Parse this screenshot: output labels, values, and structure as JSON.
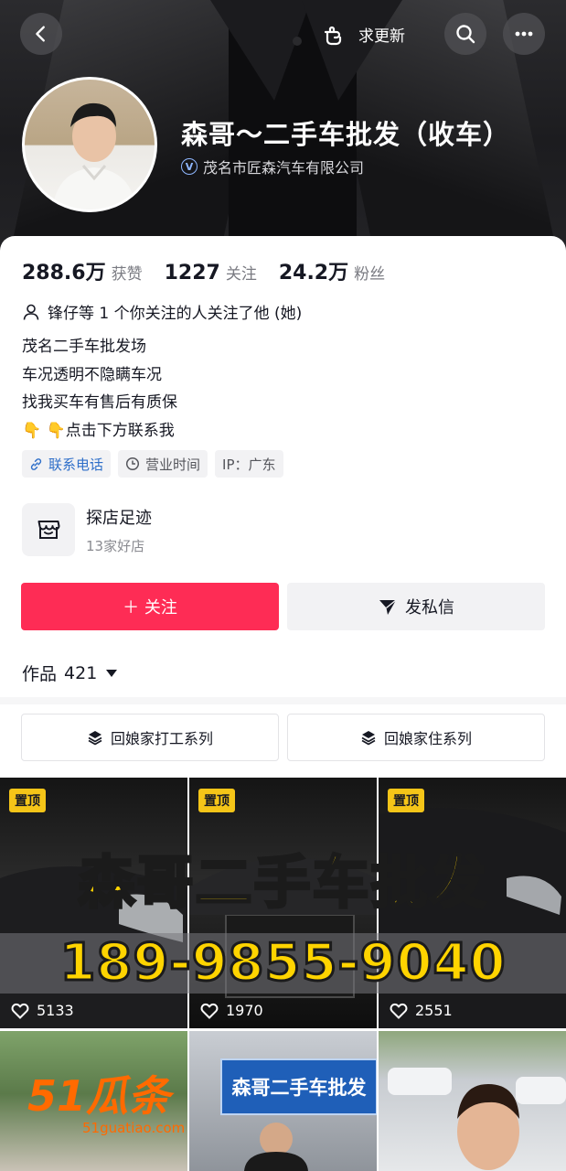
{
  "top_bar": {
    "back_icon": "chevron-left-icon",
    "refresh_label": "求更新",
    "search_icon": "search-icon",
    "more_icon": "more-horizontal-icon"
  },
  "profile": {
    "name": "森哥～二手车批发（收车）",
    "verified_org": "茂名市匠森汽车有限公司"
  },
  "stats": [
    {
      "num": "288.6万",
      "label": "获赞"
    },
    {
      "num": "1227",
      "label": "关注"
    },
    {
      "num": "24.2万",
      "label": "粉丝"
    }
  ],
  "mutual_text": "锋仔等 1 个你关注的人关注了他 (她)",
  "bio": [
    "茂名二手车批发场",
    "车况透明不隐瞒车况",
    "找我买车有售后有质保",
    "👇 👇点击下方联系我"
  ],
  "tags": {
    "contact": "联系电话",
    "hours": "营业时间",
    "ip": "IP：广东"
  },
  "shop": {
    "title": "探店足迹",
    "subtitle": "13家好店"
  },
  "actions": {
    "follow": "＋ 关注",
    "message": "发私信"
  },
  "works": {
    "label": "作品",
    "count": "421"
  },
  "collections": [
    {
      "label": "回娘家打工系列"
    },
    {
      "label": "回娘家住系列"
    }
  ],
  "videos": {
    "pinned_label": "置顶",
    "banner_title": "森哥二手车批发",
    "banner_phone": "189-9855-9040",
    "likes": [
      "5133",
      "1970",
      "2551"
    ],
    "store_sign": "森哥二手车批发"
  },
  "watermark": {
    "logo": "51瓜条",
    "site": "51guatiao.com"
  },
  "colors": {
    "accent": "#fe2c55",
    "link": "#2f6fc9",
    "pin": "#f5c518",
    "banner_text": "#ffd400"
  }
}
